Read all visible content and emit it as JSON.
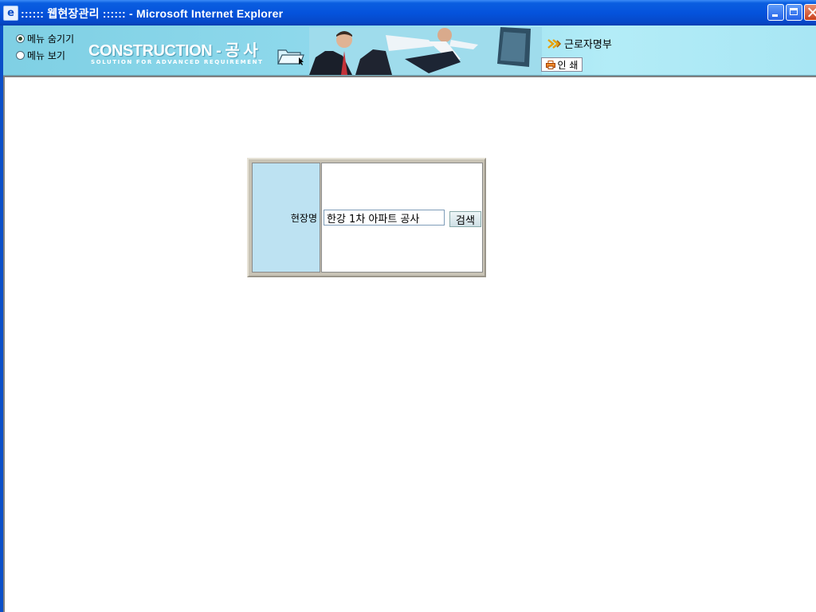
{
  "window": {
    "title": ":::::: 웹현장관리 :::::: - Microsoft Internet Explorer",
    "icon": "ie-icon"
  },
  "header": {
    "menu_options": [
      {
        "label": "메뉴 숨기기",
        "checked": true
      },
      {
        "label": "메뉴 보기",
        "checked": false
      }
    ],
    "brand_title": "CONSTRUCTION - 공 사",
    "brand_subtitle": "SOLUTION FOR ADVANCED REQUIREMENT",
    "nav_link": "근로자명부",
    "print_label": "인 쇄"
  },
  "search": {
    "label": "현장명",
    "site_value": "한강 1차 아파트 공사",
    "button_label": "검색"
  },
  "colors": {
    "banner": "#8fd9ec",
    "label_cell": "#bde2f2",
    "titlebar": "#0553dc"
  }
}
